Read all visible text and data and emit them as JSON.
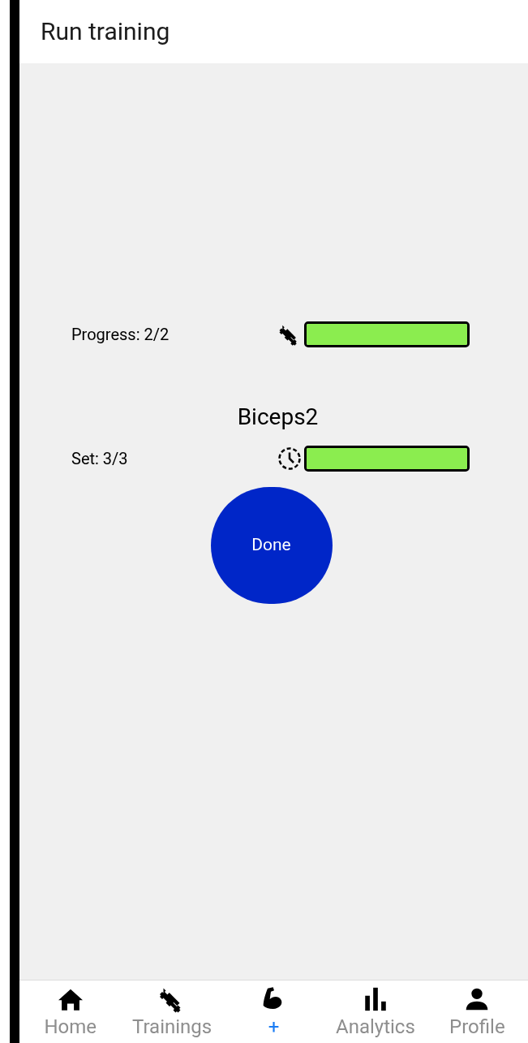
{
  "header": {
    "title": "Run training"
  },
  "progress": {
    "label": "Progress: 2/2",
    "level": 1
  },
  "exercise": {
    "name": "Biceps2"
  },
  "set": {
    "label": "Set: 3/3",
    "level": 1
  },
  "done_button": {
    "label": "Done"
  },
  "tab_bar": [
    {
      "kind": "home",
      "label": "Home",
      "selected": false
    },
    {
      "kind": "trainings",
      "label": "Trainings",
      "selected": false
    },
    {
      "kind": "run",
      "label": "+",
      "selected": true
    },
    {
      "kind": "analytics",
      "label": "Analytics",
      "selected": false
    },
    {
      "kind": "profile",
      "label": "Profile",
      "selected": false
    }
  ]
}
